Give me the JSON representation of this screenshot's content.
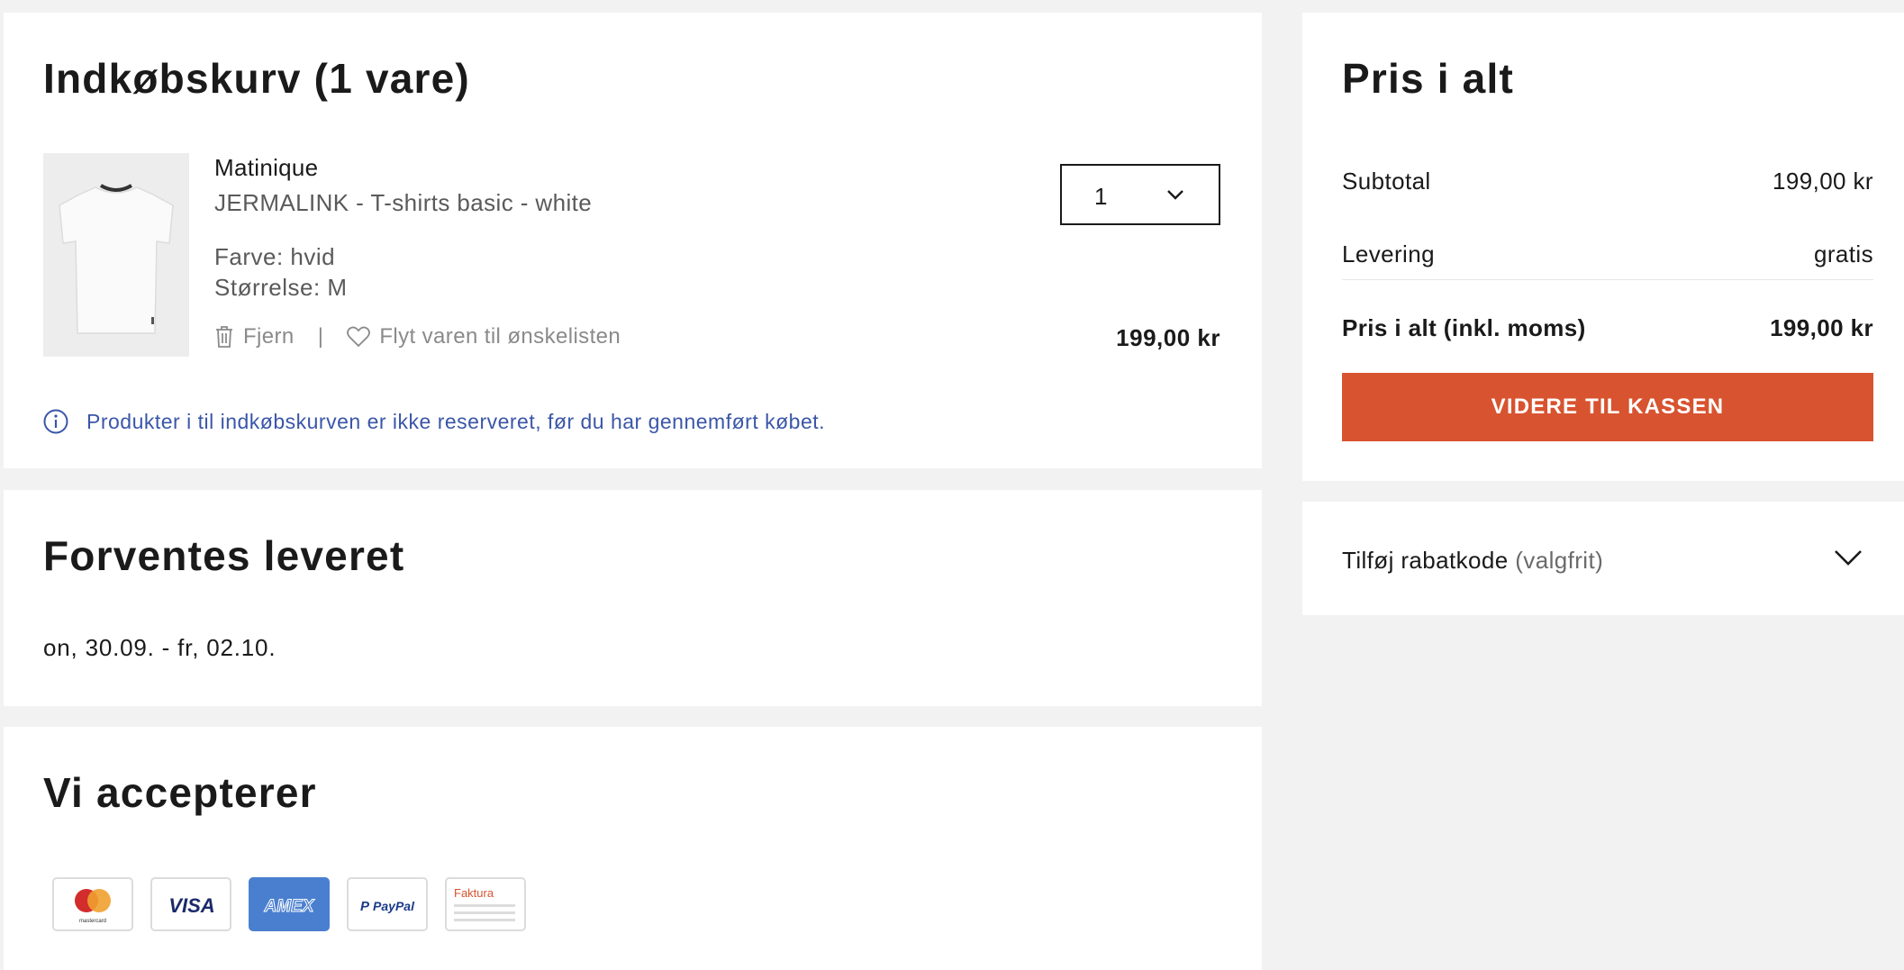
{
  "cart": {
    "title": "Indkøbskurv (1 vare)",
    "item": {
      "brand": "Matinique",
      "name": "JERMALINK - T-shirts basic - white",
      "color": "Farve: hvid",
      "size": "Størrelse: M",
      "quantity": "1",
      "price": "199,00 kr",
      "remove_label": "Fjern",
      "separator": "|",
      "wishlist_label": "Flyt varen til ønskelisten"
    },
    "notice": "Produkter i til indkøbskurven er ikke reserveret, før du har gennemført købet."
  },
  "delivery": {
    "title": "Forventes leveret",
    "date_range": "on, 30.09. - fr, 02.10."
  },
  "payment": {
    "title": "Vi accepterer",
    "methods": [
      {
        "name": "mastercard",
        "label": "mastercard"
      },
      {
        "name": "visa",
        "label": "VISA"
      },
      {
        "name": "amex",
        "label": "AMEX"
      },
      {
        "name": "paypal",
        "label": "PayPal"
      },
      {
        "name": "invoice",
        "label": "Faktura"
      }
    ]
  },
  "summary": {
    "title": "Pris i alt",
    "subtotal_label": "Subtotal",
    "subtotal_value": "199,00 kr",
    "delivery_label": "Levering",
    "delivery_value": "gratis",
    "total_label": "Pris i alt (inkl. moms)",
    "total_value": "199,00 kr",
    "checkout_label": "VIDERE TIL KASSEN"
  },
  "discount": {
    "label": "Tilføj rabatkode",
    "optional": "(valgfrit)"
  },
  "colors": {
    "accent": "#d8532f",
    "info": "#3a56a8",
    "background": "#f2f2f2"
  }
}
